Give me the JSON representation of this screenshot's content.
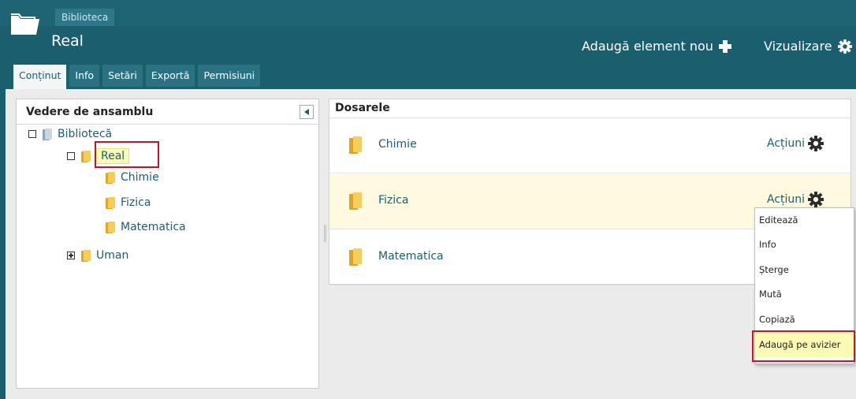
{
  "header": {
    "breadcrumb": "Biblioteca",
    "title": "Real",
    "add_label": "Adaugă element nou",
    "view_label": "Vizualizare",
    "brand_color": "#1b5f6f"
  },
  "tabs": [
    {
      "label": "Conținut",
      "active": true
    },
    {
      "label": "Info"
    },
    {
      "label": "Setări"
    },
    {
      "label": "Exportă"
    },
    {
      "label": "Permisiuni"
    }
  ],
  "overview": {
    "title": "Vedere de ansamblu",
    "tree": [
      {
        "label": "Bibliotecă",
        "expanded": true
      },
      {
        "label": "Real",
        "expanded": true,
        "selected": true
      },
      {
        "label": "Chimie"
      },
      {
        "label": "Fizica"
      },
      {
        "label": "Matematica"
      },
      {
        "label": "Uman",
        "expanded": false
      }
    ]
  },
  "folders": {
    "title": "Dosarele",
    "rows": [
      {
        "name": "Chimie",
        "actions": "Acțiuni"
      },
      {
        "name": "Fizica",
        "actions": "Acțiuni",
        "highlighted": true
      },
      {
        "name": "Matematica"
      }
    ]
  },
  "actions_menu": {
    "items": [
      {
        "label": "Editează"
      },
      {
        "label": "Info"
      },
      {
        "label": "Șterge"
      },
      {
        "label": "Mută"
      },
      {
        "label": "Copiază"
      },
      {
        "label": "Adaugă pe avizier",
        "highlighted": true
      }
    ]
  }
}
